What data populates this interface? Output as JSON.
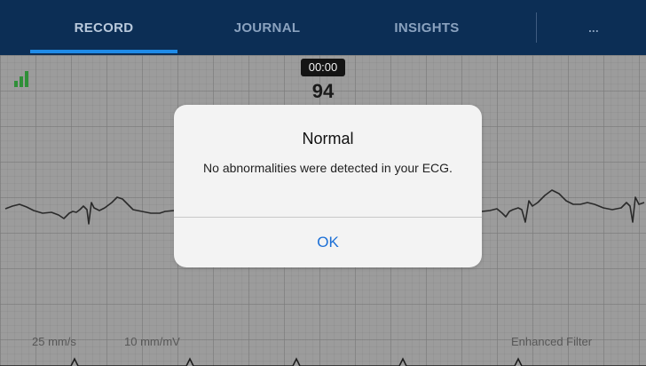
{
  "nav": {
    "tabs": [
      {
        "label": "RECORD",
        "active": true
      },
      {
        "label": "JOURNAL",
        "active": false
      },
      {
        "label": "INSIGHTS",
        "active": false
      }
    ],
    "more_label": "...",
    "accent_color": "#1f8be8",
    "background_color": "#0c2e55"
  },
  "recording": {
    "signal_icon": "signal-strength-icon",
    "timer": "00:00",
    "heart_rate": "94"
  },
  "footer": {
    "paper_speed": "25 mm/s",
    "gain": "10 mm/mV",
    "filter": "Enhanced Filter"
  },
  "dialog": {
    "title": "Normal",
    "message": "No abnormalities were detected in your ECG.",
    "ok_label": "OK",
    "action_color": "#1b6fd6"
  }
}
